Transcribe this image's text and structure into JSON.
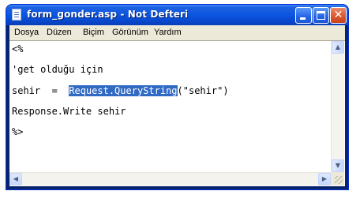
{
  "window": {
    "title": "form_gonder.asp - Not Defteri",
    "controls": {
      "minimize": "minimize-icon",
      "maximize": "maximize-icon",
      "close": "close-icon"
    }
  },
  "menu": [
    "Dosya",
    "Düzen",
    "Biçim",
    "Görünüm",
    "Yardım"
  ],
  "editor": {
    "line1": "<%",
    "line2": "'get olduğu için",
    "line3_before": "sehir  =  ",
    "line3_selected": "Request.QueryString",
    "line3_after": "(\"sehir\")",
    "line4": "Response.Write sehir",
    "line5": "%>"
  },
  "icons": {
    "app": "notepad-icon",
    "scroll_up": "arrow-up-icon",
    "scroll_down": "arrow-down-icon",
    "scroll_left": "arrow-left-icon",
    "scroll_right": "arrow-right-icon",
    "resize": "resize-grip-icon"
  },
  "colors": {
    "selection": "#316ac5",
    "titlebar": "#0a55e0",
    "menubar": "#ece9d8"
  }
}
